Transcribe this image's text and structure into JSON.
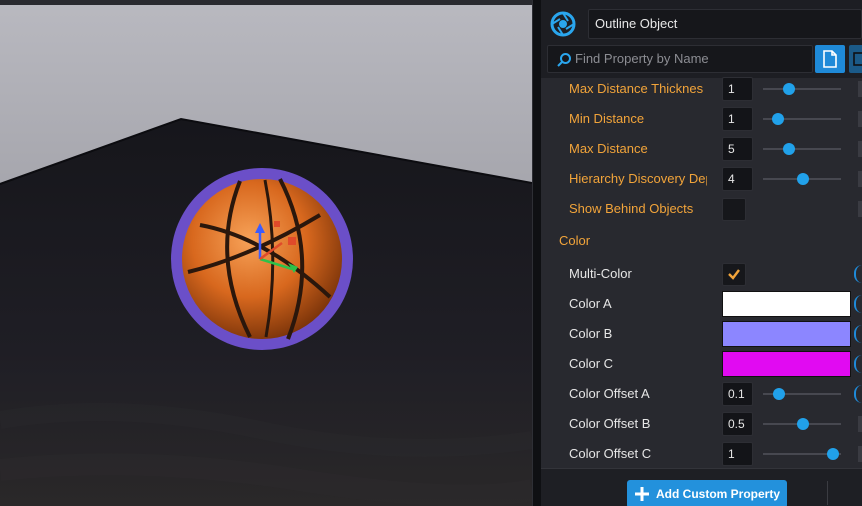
{
  "header": {
    "object_name": "Outline Object"
  },
  "search": {
    "placeholder": "Find Property by Name"
  },
  "properties": {
    "max_distance_thickness": {
      "label": "Max Distance Thicknes",
      "value": "1",
      "slider_fraction": 0.33
    },
    "min_distance": {
      "label": "Min Distance",
      "value": "1",
      "slider_fraction": 0.19
    },
    "max_distance": {
      "label": "Max Distance",
      "value": "5",
      "slider_fraction": 0.33
    },
    "hierarchy_discovery_depth": {
      "label": "Hierarchy Discovery Dep",
      "value": "4",
      "slider_fraction": 0.51
    },
    "show_behind_objects": {
      "label": "Show Behind Objects",
      "checked": false
    }
  },
  "color_section": {
    "title": "Color",
    "multi_color": {
      "label": "Multi-Color",
      "checked": true
    },
    "color_a": {
      "label": "Color A",
      "color": "#ffffff"
    },
    "color_b": {
      "label": "Color B",
      "color": "#8c86ff"
    },
    "color_c": {
      "label": "Color C",
      "color": "#e10af2"
    },
    "color_offset_a": {
      "label": "Color Offset A",
      "value": "0.1",
      "slider_fraction": 0.21
    },
    "color_offset_b": {
      "label": "Color Offset B",
      "value": "0.5",
      "slider_fraction": 0.51
    },
    "color_offset_c": {
      "label": "Color Offset C",
      "value": "1",
      "slider_fraction": 0.9
    }
  },
  "footer": {
    "add_custom_property": "Add Custom Property"
  },
  "colors": {
    "accent_blue": "#21a1ea",
    "label_orange": "#f2a43a",
    "outline_purple": "#6b4fc8"
  },
  "icons": {
    "logo": "portal-logo-icon",
    "search": "search-icon",
    "doc": "document-icon",
    "add": "plus-icon",
    "check": "checkmark-icon"
  }
}
